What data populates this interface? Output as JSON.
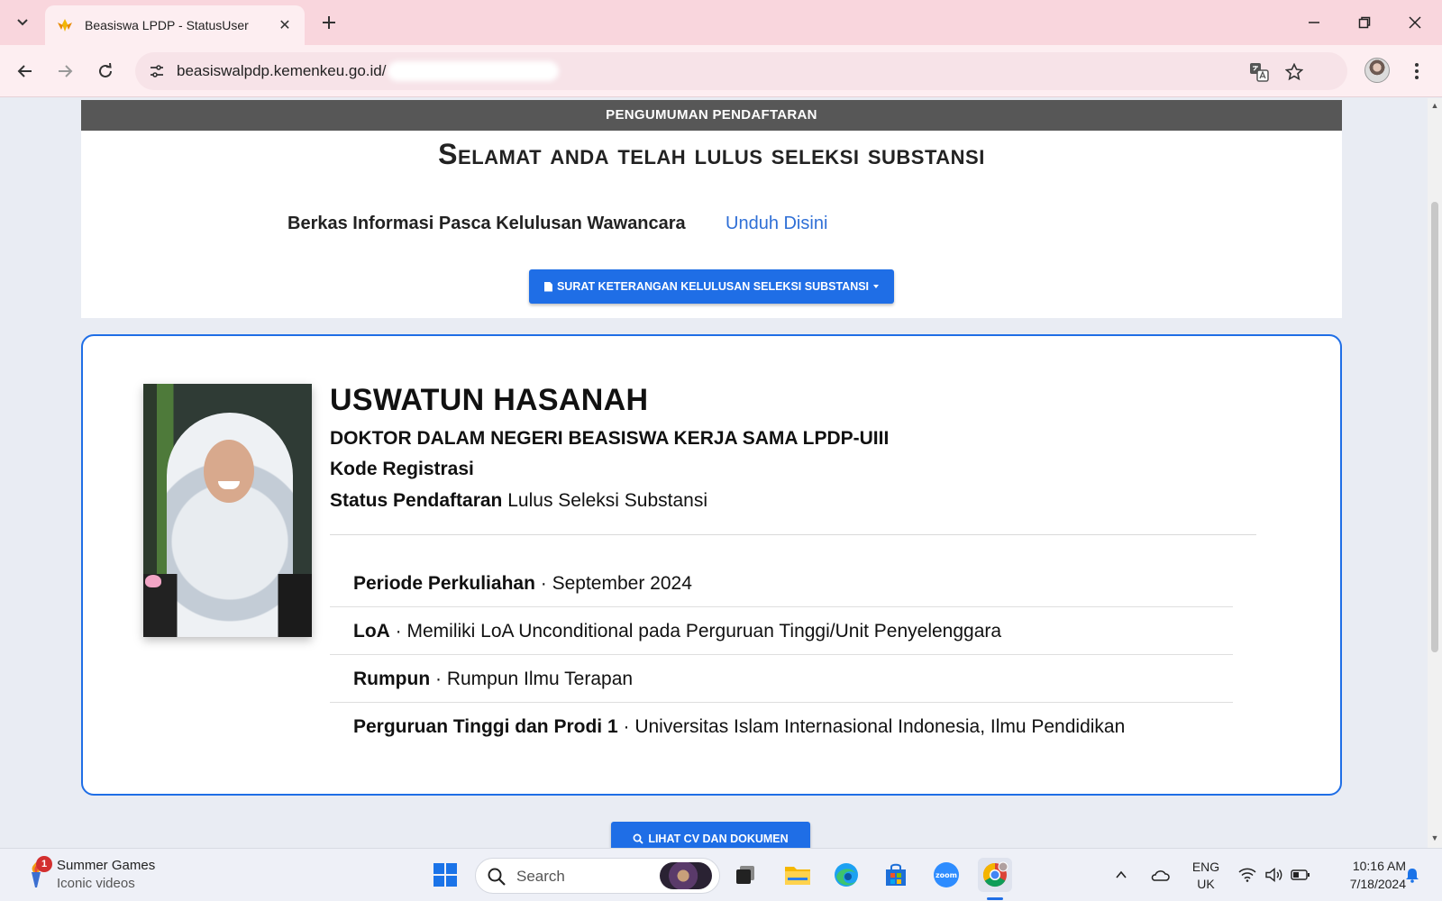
{
  "browser": {
    "tab_title": "Beasiswa LPDP - StatusUser",
    "url": "beasiswalpdp.kemenkeu.go.id/",
    "new_tab_symbol": "+",
    "close_symbol": "✕"
  },
  "page": {
    "announcement_bar": "PENGUMUMAN PENDAFTARAN",
    "headline": "Selamat anda telah lulus seleksi substansi",
    "berkas_label": "Berkas Informasi Pasca Kelulusan Wawancara",
    "berkas_link": "Unduh Disini",
    "surat_button": "SURAT KETERANGAN KELULUSAN SELEKSI SUBSTANSI",
    "profile": {
      "name": "USWATUN HASANAH",
      "program": "DOKTOR DALAM NEGERI BEASISWA KERJA SAMA LPDP-UIII",
      "kode_label": "Kode Registrasi",
      "status_label": "Status Pendaftaran",
      "status_value": "Lulus Seleksi Substansi"
    },
    "details": [
      {
        "label": "Periode Perkuliahan",
        "value": "September 2024"
      },
      {
        "label": "LoA",
        "value": "Memiliki LoA Unconditional pada Perguruan Tinggi/Unit Penyelenggara"
      },
      {
        "label": "Rumpun",
        "value": "Rumpun Ilmu Terapan"
      },
      {
        "label": "Perguruan Tinggi dan Prodi 1",
        "value": "Universitas Islam Internasional Indonesia, Ilmu Pendidikan"
      }
    ],
    "separator": " · ",
    "cv_button": "LIHAT CV DAN DOKUMEN"
  },
  "taskbar": {
    "widget_badge": "1",
    "widget_title": "Summer Games",
    "widget_subtitle": "Iconic videos",
    "search_placeholder": "Search",
    "lang_line1": "ENG",
    "lang_line2": "UK",
    "time": "10:16 AM",
    "date": "7/18/2024"
  },
  "colors": {
    "accent": "#1f6ee6",
    "link": "#2f6fd6",
    "tabstrip": "#f9d6dd",
    "announcement": "#575757"
  }
}
